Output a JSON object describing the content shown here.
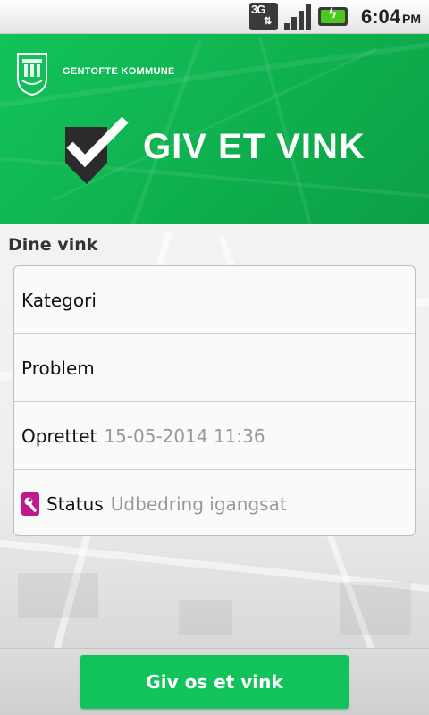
{
  "status_bar": {
    "network": "3G",
    "time": "6:04",
    "ampm": "PM",
    "icons": [
      "network-3g-icon",
      "signal-strength-icon",
      "battery-charging-icon"
    ],
    "battery_color": "#4cc91e"
  },
  "header": {
    "organization": "GENTOFTE KOMMUNE",
    "app_title": "GIV ET VINK",
    "icons": [
      "municipality-crest-icon",
      "checkmark-logo-icon"
    ],
    "background_color": "#12c25a"
  },
  "main": {
    "section_title": "Dine vink",
    "rows": {
      "kategori": {
        "label": "Kategori",
        "value": ""
      },
      "problem": {
        "label": "Problem",
        "value": ""
      },
      "oprettet": {
        "label": "Oprettet",
        "value": "15-05-2014 11:36"
      },
      "status": {
        "label": "Status",
        "value": "Udbedring igangsat",
        "icon": "wrench-status-icon",
        "icon_color": "#c0198f"
      }
    }
  },
  "footer": {
    "button_label": "Giv os et vink",
    "button_color": "#12c25a"
  }
}
